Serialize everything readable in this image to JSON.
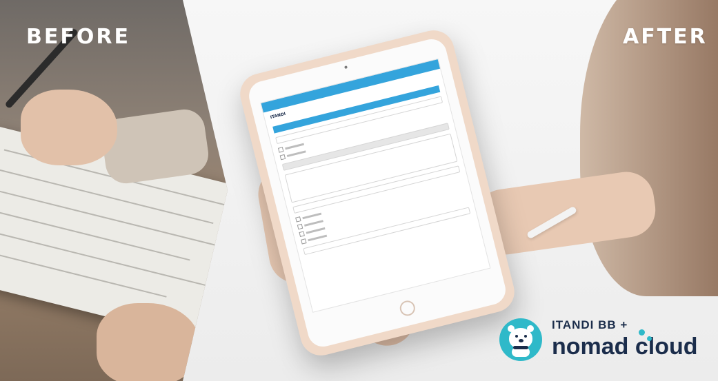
{
  "labels": {
    "before": "BEFORE",
    "after": "AFTER"
  },
  "logo": {
    "brand_top": "ITANDI BB +",
    "brand_main": "nomad cloud",
    "icon": "polar-bear-icon",
    "accent_color": "#2fb9c9",
    "text_color": "#1b2d4b"
  },
  "tablet_screen": {
    "app_logo": "ITANDI",
    "accent_color": "#34a4dc"
  }
}
